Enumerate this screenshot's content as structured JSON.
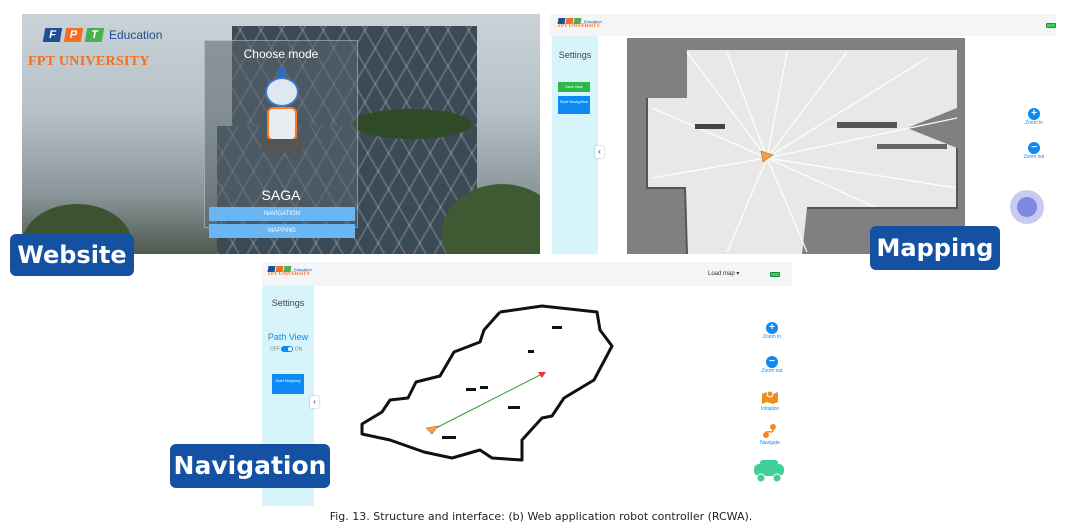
{
  "website": {
    "brand": {
      "letters": [
        "F",
        "P",
        "T"
      ],
      "edu": "Education",
      "university": "FPT UNIVERSITY"
    },
    "mode_panel": {
      "title": "Choose mode",
      "robot_name": "SAGA",
      "buttons": [
        "NAVIGATION",
        "MAPPING"
      ]
    },
    "tag": "Website"
  },
  "mapping": {
    "brand": {
      "edu": "Education",
      "university": "FPT UNIVERSITY"
    },
    "sidebar": {
      "title": "Settings",
      "buttons": [
        "Save Map",
        "Start Navigation"
      ],
      "collapse_icon": "‹"
    },
    "controls": {
      "zoom_in": "Zoom in",
      "zoom_out": "Zoom out"
    },
    "tag": "Mapping"
  },
  "navigation": {
    "brand": {
      "edu": "Education",
      "university": "FPT UNIVERSITY"
    },
    "top": {
      "load_map": "Load map ▾"
    },
    "sidebar": {
      "title": "Settings",
      "path_view": "Path View",
      "toggle_off": "OFF",
      "toggle_on": "ON",
      "start_button": "Start Mapping",
      "collapse_icon": "‹"
    },
    "controls": {
      "zoom_in": "Zoom in",
      "zoom_out": "Zoom out",
      "initialize": "Initialize",
      "navigate": "Navigate"
    },
    "tag": "Navigation"
  },
  "colors": {
    "brand_orange": "#f26f21",
    "brand_blue": "#1d4f97",
    "fpt_green": "#4caf50",
    "accent_blue": "#0d8bf5",
    "tag_bg": "#1551a3",
    "sidebar": "#d7f4fb"
  },
  "caption": "Fig. 13. Structure and interface: (b) Web application robot controller (RCWA)."
}
